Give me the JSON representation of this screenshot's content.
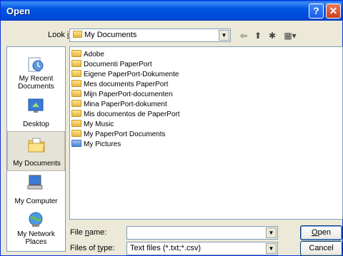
{
  "window": {
    "title": "Open"
  },
  "titlebar": {
    "help": "?",
    "close": "✕"
  },
  "lookin": {
    "label": "Look in:",
    "value": "My Documents"
  },
  "toolbar": {
    "back": "⇦",
    "up": "⬆",
    "newfolder": "✱",
    "views": "▦▾"
  },
  "places": [
    {
      "label": "My Recent Documents",
      "icon": "recent-documents-icon"
    },
    {
      "label": "Desktop",
      "icon": "desktop-icon"
    },
    {
      "label": "My Documents",
      "icon": "my-documents-icon",
      "selected": true
    },
    {
      "label": "My Computer",
      "icon": "my-computer-icon"
    },
    {
      "label": "My Network Places",
      "icon": "network-places-icon"
    }
  ],
  "files": [
    {
      "name": "Adobe",
      "icon": "folder-icon"
    },
    {
      "name": "Documenti PaperPort",
      "icon": "folder-icon"
    },
    {
      "name": "Eigene PaperPort-Dokumente",
      "icon": "folder-icon"
    },
    {
      "name": "Mes documents PaperPort",
      "icon": "folder-icon"
    },
    {
      "name": "Mijn PaperPort-documenten",
      "icon": "folder-icon"
    },
    {
      "name": "Mina PaperPort-dokument",
      "icon": "folder-icon"
    },
    {
      "name": "Mis documentos de PaperPort",
      "icon": "folder-icon"
    },
    {
      "name": "My Music",
      "icon": "music-folder-icon"
    },
    {
      "name": "My PaperPort Documents",
      "icon": "folder-icon"
    },
    {
      "name": "My Pictures",
      "icon": "pictures-folder-icon"
    }
  ],
  "filename": {
    "label": "File name:",
    "value": ""
  },
  "filetype": {
    "label": "Files of type:",
    "value": "Text files (*.txt;*.csv)"
  },
  "buttons": {
    "open": "Open",
    "cancel": "Cancel"
  }
}
